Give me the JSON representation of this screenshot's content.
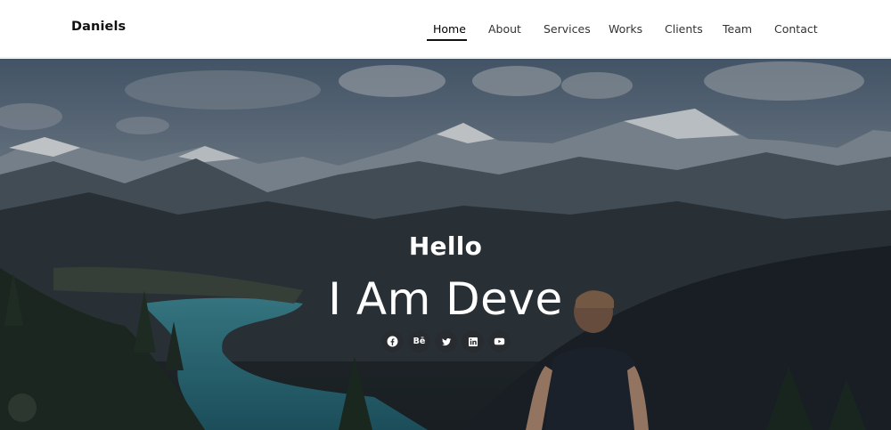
{
  "brand": "Daniels",
  "nav": [
    {
      "label": "Home",
      "active": true
    },
    {
      "label": "About"
    },
    {
      "label": "Services"
    },
    {
      "label": "Works"
    },
    {
      "label": "Clients"
    },
    {
      "label": "Team"
    },
    {
      "label": "Contact"
    }
  ],
  "hero": {
    "greeting": "Hello",
    "typed_text": "I Am Deve"
  },
  "social": [
    {
      "icon": "facebook-icon"
    },
    {
      "icon": "behance-icon",
      "glyph": "Bē"
    },
    {
      "icon": "twitter-icon"
    },
    {
      "icon": "linkedin-icon"
    },
    {
      "icon": "youtube-icon"
    }
  ],
  "colors": {
    "nav_text": "#333333",
    "nav_active_underline": "#111111",
    "hero_text": "#ffffff",
    "social_bg": "#282c30"
  }
}
